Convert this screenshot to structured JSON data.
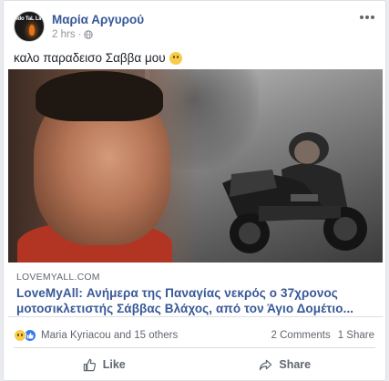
{
  "post": {
    "author": "Μαρία Αργυρού",
    "time": "2 hrs",
    "dot": "·",
    "text": "καλο παραδεισο Σαββα μου",
    "avatar_text": "Ido TaL LiK",
    "icons": {
      "privacy": "globe-icon",
      "options": "more-icon",
      "feeling": "sad-emoji-icon"
    }
  },
  "link": {
    "domain": "LOVEMYALL.COM",
    "title": "LoveMyAll: Ανήμερα της Παναγίας νεκρός ο 37χρονος μοτοσικλετιστής Σάββας Βλάχος, από τον Άγιο Δομέτιο..."
  },
  "reactions": {
    "names": "Maria Kyriacou and 15 others",
    "comments": "2 Comments",
    "shares": "1 Share",
    "icons": [
      "sad-reaction-icon",
      "like-reaction-icon"
    ]
  },
  "actions": {
    "like": "Like",
    "share": "Share"
  },
  "colors": {
    "link_blue": "#385898",
    "meta_gray": "#90949c",
    "background": "#e9ebee"
  }
}
